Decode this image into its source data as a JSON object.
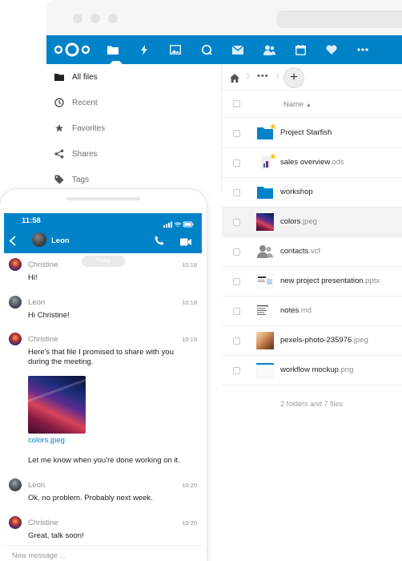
{
  "colors": {
    "accent": "#0082c9",
    "header_bg": "#0082c9",
    "star": "#f6c026",
    "link": "#0082c9"
  },
  "header": {
    "nav_icons": [
      "files-folder-icon",
      "activity-bolt-icon",
      "photos-icon",
      "talk-icon",
      "mail-icon",
      "contacts-icon",
      "calendar-icon",
      "favorites-heart-icon",
      "more-apps-icon"
    ]
  },
  "sidebar": {
    "items": [
      {
        "label": "All files",
        "icon": "folder-icon"
      },
      {
        "label": "Recent",
        "icon": "clock-icon"
      },
      {
        "label": "Favorites",
        "icon": "star-icon"
      },
      {
        "label": "Shares",
        "icon": "share-icon"
      },
      {
        "label": "Tags",
        "icon": "tag-icon"
      }
    ]
  },
  "files": {
    "breadcrumb_more": "•••",
    "add_label": "+",
    "column_name": "Name",
    "rows": [
      {
        "name": "Project Starfish",
        "ext": "",
        "type": "folder",
        "favorite": true
      },
      {
        "name": "sales overview",
        "ext": ".ods",
        "type": "spreadsheet",
        "favorite": true
      },
      {
        "name": "workshop",
        "ext": "",
        "type": "folder",
        "favorite": false
      },
      {
        "name": "colors",
        "ext": ".jpeg",
        "type": "image",
        "favorite": false
      },
      {
        "name": "contacts",
        "ext": ".vcf",
        "type": "contacts",
        "favorite": false
      },
      {
        "name": "new project presentation",
        "ext": ".pptx",
        "type": "presentation",
        "favorite": false
      },
      {
        "name": "notes",
        "ext": ".md",
        "type": "text",
        "favorite": false
      },
      {
        "name": "pexels-photo-235976",
        "ext": ".jpeg",
        "type": "image",
        "favorite": false
      },
      {
        "name": "workflow mockup",
        "ext": ".png",
        "type": "image",
        "favorite": false
      }
    ],
    "summary": "2 folders and 7 files"
  },
  "phone": {
    "time": "11:58",
    "contact": "Leon",
    "today": "Today",
    "messages": [
      {
        "author": "Christine",
        "time": "10:18",
        "text": "Hi!"
      },
      {
        "author": "Leon",
        "time": "10:18",
        "text": "Hi Christine!"
      },
      {
        "author": "Christine",
        "time": "10:19",
        "text": "Here's that file I promised to share with you during the meeting."
      },
      {
        "author": "",
        "time": "",
        "text": "Let me know when you're done working on it."
      },
      {
        "author": "Leon",
        "time": "10:20",
        "text": "Ok, no problem. Probably next week."
      },
      {
        "author": "Christine",
        "time": "10:20",
        "text": "Great, talk soon!"
      }
    ],
    "shared_file": "colors.jpeg",
    "composer_placeholder": "New message ..."
  }
}
